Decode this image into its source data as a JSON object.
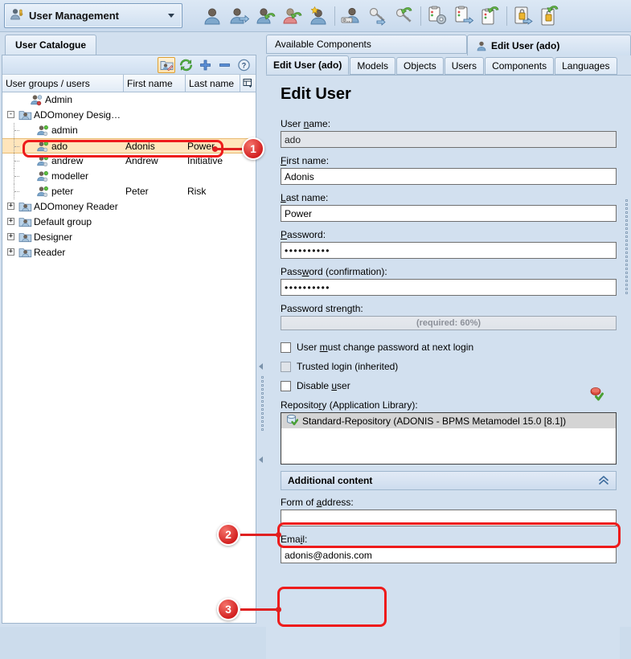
{
  "window": {
    "module_selector": {
      "label": "User Management",
      "icon": "user-key-icon"
    },
    "toolbar_buttons": [
      {
        "name": "new-user",
        "icon": "user-icon"
      },
      {
        "name": "duplicate-user",
        "icon": "user-copy-icon"
      },
      {
        "name": "import-user",
        "icon": "user-import-icon"
      },
      {
        "name": "delete-user",
        "icon": "user-delete-icon"
      },
      {
        "name": "favourite-user",
        "icon": "user-star-icon"
      },
      {
        "name": "separator-1",
        "icon": "separator"
      },
      {
        "name": "user-rights",
        "icon": "user-key-small-icon"
      },
      {
        "name": "assign-rights",
        "icon": "key-assign-icon"
      },
      {
        "name": "revoke-rights",
        "icon": "key-revoke-icon"
      },
      {
        "name": "separator-2",
        "icon": "separator"
      },
      {
        "name": "settings",
        "icon": "clipboard-gear-icon"
      },
      {
        "name": "clipboard-copy",
        "icon": "clipboard-copy-icon"
      },
      {
        "name": "clipboard-import",
        "icon": "clipboard-import-icon"
      },
      {
        "name": "separator-3",
        "icon": "separator"
      },
      {
        "name": "lock-user",
        "icon": "lock-icon"
      },
      {
        "name": "unlock-user",
        "icon": "lock-open-icon"
      }
    ]
  },
  "left_panel": {
    "tab_label": "User Catalogue",
    "toolbar": [
      {
        "name": "edit-user-toolbutton",
        "icon": "user-edit-icon",
        "selected": true
      },
      {
        "name": "refresh-toolbutton",
        "icon": "refresh-icon",
        "selected": false
      },
      {
        "name": "add-toolbutton",
        "icon": "plus-icon",
        "selected": false
      },
      {
        "name": "remove-toolbutton",
        "icon": "minus-icon",
        "selected": false
      },
      {
        "name": "help-toolbutton",
        "icon": "help-icon",
        "selected": false
      }
    ],
    "columns": [
      "User groups / users",
      "First name",
      "Last name"
    ],
    "column_menu_icon": "column-chooser-icon",
    "rows": [
      {
        "indent": 1,
        "expander": "",
        "icon": "user-admin-icon",
        "label": "Admin",
        "first": "",
        "last": "",
        "selected": false
      },
      {
        "indent": 0,
        "expander": "-",
        "icon": "group-icon",
        "label": "ADOmoney Desig…",
        "first": "",
        "last": "",
        "selected": false
      },
      {
        "indent": 2,
        "expander": "",
        "icon": "user-online-icon",
        "label": "admin",
        "first": "",
        "last": "",
        "selected": false
      },
      {
        "indent": 2,
        "expander": "",
        "icon": "user-online-icon",
        "label": "ado",
        "first": "Adonis",
        "last": "Power",
        "selected": true
      },
      {
        "indent": 2,
        "expander": "",
        "icon": "user-online-icon",
        "label": "andrew",
        "first": "Andrew",
        "last": "Initiative",
        "selected": false
      },
      {
        "indent": 2,
        "expander": "",
        "icon": "user-online-icon",
        "label": "modeller",
        "first": "",
        "last": "",
        "selected": false
      },
      {
        "indent": 2,
        "expander": "",
        "icon": "user-online-icon",
        "label": "peter",
        "first": "Peter",
        "last": "Risk",
        "selected": false
      },
      {
        "indent": 0,
        "expander": "+",
        "icon": "group-icon",
        "label": "ADOmoney Reader",
        "first": "",
        "last": "",
        "selected": false
      },
      {
        "indent": 0,
        "expander": "+",
        "icon": "group-icon",
        "label": "Default group",
        "first": "",
        "last": "",
        "selected": false
      },
      {
        "indent": 0,
        "expander": "+",
        "icon": "group-icon",
        "label": "Designer",
        "first": "",
        "last": "",
        "selected": false
      },
      {
        "indent": 0,
        "expander": "+",
        "icon": "group-icon",
        "label": "Reader",
        "first": "",
        "last": "",
        "selected": false
      }
    ]
  },
  "right_panel": {
    "outer_tabs": [
      {
        "label": "Available Components",
        "active": false,
        "icon": ""
      },
      {
        "label": "Edit User (ado)",
        "active": true,
        "icon": "user-icon"
      }
    ],
    "inner_tabs": [
      {
        "label": "Edit User (ado)",
        "active": true
      },
      {
        "label": "Models",
        "active": false
      },
      {
        "label": "Objects",
        "active": false
      },
      {
        "label": "Users",
        "active": false
      },
      {
        "label": "Components",
        "active": false
      },
      {
        "label": "Languages",
        "active": false
      }
    ],
    "form": {
      "title": "Edit User",
      "fields": {
        "user_name": {
          "label_pre": "User ",
          "label_key": "n",
          "label_post": "ame:",
          "value": "ado",
          "disabled": true
        },
        "first_name": {
          "label_pre": "",
          "label_key": "F",
          "label_post": "irst name:",
          "value": "Adonis",
          "disabled": false
        },
        "last_name": {
          "label_pre": "",
          "label_key": "L",
          "label_post": "ast name:",
          "value": "Power",
          "disabled": false
        },
        "password": {
          "label_pre": "",
          "label_key": "P",
          "label_post": "assword:",
          "value": "••••••••••",
          "disabled": false
        },
        "password_confirm": {
          "label_pre": "Pass",
          "label_key": "w",
          "label_post": "ord (confirmation):",
          "value": "••••••••••",
          "disabled": false
        },
        "password_strength": {
          "label_pre": "Password stren",
          "label_key": "g",
          "label_post": "th:",
          "value": "(required: 60%)",
          "required_percent": 60,
          "progress_percent": 0
        },
        "form_of_address": {
          "label_pre": "Form of ",
          "label_key": "a",
          "label_post": "ddress:",
          "value": "",
          "disabled": false
        },
        "email": {
          "label_pre": "Ema",
          "label_key": "i",
          "label_post": "l:",
          "value": "adonis@adonis.com",
          "disabled": false
        }
      },
      "checkboxes": [
        {
          "name": "must-change-password",
          "pre": "User ",
          "key": "m",
          "post": "ust change password at next login",
          "checked": false,
          "dim": false
        },
        {
          "name": "trusted-login",
          "pre": "Trusted login (inherited)",
          "key": "",
          "post": "",
          "checked": false,
          "dim": true
        },
        {
          "name": "disable-user",
          "pre": "Disable ",
          "key": "u",
          "post": "ser",
          "checked": false,
          "dim": false
        }
      ],
      "repository": {
        "label_pre": "Reposito",
        "label_key": "r",
        "label_post": "y (Application Library):",
        "action_icon": "repository-check-icon",
        "items": [
          {
            "label": "Standard-Repository (ADONIS - BPMS Metamodel 15.0 [8.1])",
            "icon": "database-check-icon",
            "selected": true
          }
        ]
      },
      "accordion": {
        "label": "Additional content",
        "expanded": true,
        "chevron": "collapse-chevron-icon"
      }
    }
  },
  "annotations": [
    {
      "number": "1",
      "target": "selected-tree-row-ado"
    },
    {
      "number": "2",
      "target": "additional-content-accordion"
    },
    {
      "number": "3",
      "target": "email-field"
    }
  ],
  "colors": {
    "window_bg": "#d2e0ef",
    "panel_bg": "#ffffff",
    "selection": "#ffe5bb",
    "selection_border": "#e8bb72",
    "annotation_red": "#ee1b1b",
    "accent_border": "#9fb6cd"
  }
}
